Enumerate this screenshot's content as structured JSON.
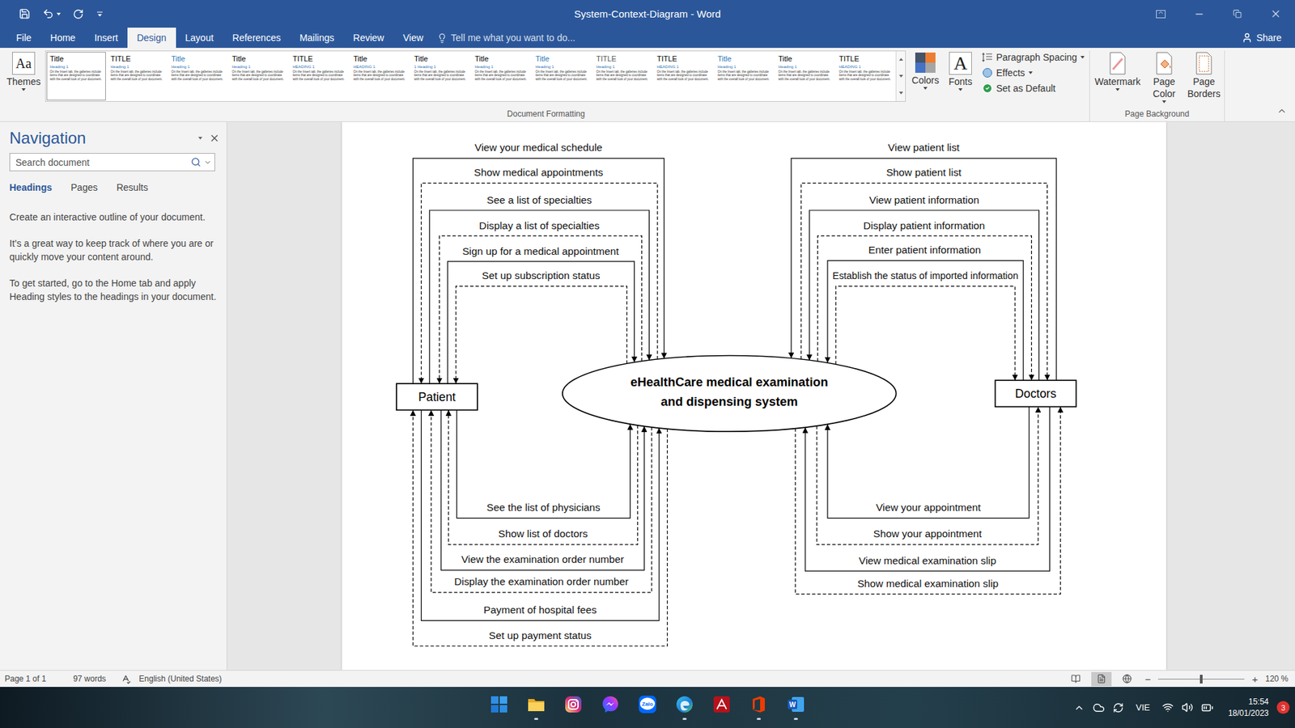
{
  "window": {
    "title": "System-Context-Diagram - Word"
  },
  "ribbon_tabs": [
    {
      "label": "File",
      "selected": false
    },
    {
      "label": "Home",
      "selected": false
    },
    {
      "label": "Insert",
      "selected": false
    },
    {
      "label": "Design",
      "selected": true
    },
    {
      "label": "Layout",
      "selected": false
    },
    {
      "label": "References",
      "selected": false
    },
    {
      "label": "Mailings",
      "selected": false
    },
    {
      "label": "Review",
      "selected": false
    },
    {
      "label": "View",
      "selected": false
    }
  ],
  "tell_me": {
    "placeholder": "Tell me what you want to do..."
  },
  "share": {
    "label": "Share"
  },
  "ribbon": {
    "themes": {
      "icon_text": "Aa",
      "label": "Themes",
      "dropdown": true
    },
    "style_gallery": {
      "sample_text": "On the Insert tab, the galleries include items that are designed to coordinate with the overall look of your document.",
      "items": [
        {
          "title": "Title",
          "heading": "Heading 1",
          "color": "#000000",
          "selected": true
        },
        {
          "title": "TITLE",
          "heading": "Heading 1",
          "color": "#000000",
          "selected": false
        },
        {
          "title": "Title",
          "heading": "Heading 1",
          "color": "#2e74b5",
          "selected": false
        },
        {
          "title": "Title",
          "heading": "Heading 1",
          "color": "#000000",
          "selected": false
        },
        {
          "title": "TITLE",
          "heading": "HEADING 1",
          "color": "#000000",
          "selected": false
        },
        {
          "title": "Title",
          "heading": "HEADING 1",
          "color": "#000000",
          "selected": false
        },
        {
          "title": "Title",
          "heading": "1 Heading 1",
          "color": "#000000",
          "selected": false
        },
        {
          "title": "Title",
          "heading": "Heading 1",
          "color": "#000000",
          "selected": false
        },
        {
          "title": "Title",
          "heading": "Heading 1",
          "color": "#2e74b5",
          "selected": false
        },
        {
          "title": "TITLE",
          "heading": "Heading 1",
          "color": "#555555",
          "selected": false
        },
        {
          "title": "TITLE",
          "heading": "HEADING 1",
          "color": "#000000",
          "selected": false
        },
        {
          "title": "Title",
          "heading": "Heading 1",
          "color": "#2e74b5",
          "selected": false
        },
        {
          "title": "Title",
          "heading": "Heading 1",
          "color": "#000000",
          "selected": false
        },
        {
          "title": "TITLE",
          "heading": "HEADING 1",
          "color": "#000000",
          "selected": false
        }
      ]
    },
    "colors": {
      "label": "Colors",
      "dropdown": true
    },
    "fonts": {
      "icon_text": "A",
      "label": "Fonts",
      "dropdown": true
    },
    "small_buttons": [
      {
        "kind": "paragraph-spacing",
        "label": "Paragraph Spacing",
        "dropdown": true
      },
      {
        "kind": "effects",
        "label": "Effects",
        "dropdown": true
      },
      {
        "kind": "set-default",
        "label": "Set as Default",
        "dropdown": false
      }
    ],
    "groups": [
      {
        "label": "Document Formatting"
      },
      {
        "label": "Page Background"
      }
    ],
    "page_background": [
      {
        "kind": "watermark",
        "lines": [
          "Watermark"
        ],
        "dropdown": true
      },
      {
        "kind": "page-color",
        "lines": [
          "Page",
          "Color"
        ],
        "dropdown": true
      },
      {
        "kind": "page-borders",
        "lines": [
          "Page",
          "Borders"
        ],
        "dropdown": false
      }
    ]
  },
  "navigation": {
    "title": "Navigation",
    "search_placeholder": "Search document",
    "tabs": [
      {
        "label": "Headings",
        "selected": true
      },
      {
        "label": "Pages",
        "selected": false
      },
      {
        "label": "Results",
        "selected": false
      }
    ],
    "paragraphs": [
      "Create an interactive outline of your document.",
      "It’s a great way to keep track of where you are or quickly move your content around.",
      "To get started, go to the Home tab and apply Heading styles to the headings in your document."
    ]
  },
  "diagram": {
    "system": {
      "lines": [
        "eHealthCare medical examination",
        "and dispensing system"
      ]
    },
    "actors": [
      {
        "name": "Patient"
      },
      {
        "name": "Doctors"
      }
    ],
    "flow_groups": [
      {
        "flows": [
          {
            "label": "View your medical schedule",
            "kind": "request"
          },
          {
            "label": "Show medical appointments",
            "kind": "response"
          },
          {
            "label": "See a list of specialties",
            "kind": "request"
          },
          {
            "label": "Display a list of specialties",
            "kind": "response"
          },
          {
            "label": "Sign up for a medical appointment",
            "kind": "request"
          },
          {
            "label": "Set up subscription status",
            "kind": "response"
          }
        ]
      },
      {
        "flows": [
          {
            "label": "See the list of physicians",
            "kind": "request"
          },
          {
            "label": "Show list of doctors",
            "kind": "response"
          },
          {
            "label": "View the examination order number",
            "kind": "request"
          },
          {
            "label": "Display the examination order number",
            "kind": "response"
          },
          {
            "label": "Payment of hospital fees",
            "kind": "request"
          },
          {
            "label": "Set up payment status",
            "kind": "response"
          }
        ]
      },
      {
        "flows": [
          {
            "label": "View patient list",
            "kind": "request"
          },
          {
            "label": "Show patient list",
            "kind": "response"
          },
          {
            "label": "View patient information",
            "kind": "request"
          },
          {
            "label": "Display patient information",
            "kind": "response"
          },
          {
            "label": "Enter patient information",
            "kind": "request"
          },
          {
            "label": "Establish the status of imported information",
            "kind": "response"
          }
        ]
      },
      {
        "flows": [
          {
            "label": "View your appointment",
            "kind": "request"
          },
          {
            "label": "Show your appointment",
            "kind": "response"
          },
          {
            "label": "View medical examination slip",
            "kind": "request"
          },
          {
            "label": "Show medical examination slip",
            "kind": "response"
          }
        ]
      }
    ]
  },
  "status_bar": {
    "page": "Page 1 of 1",
    "words": "97 words",
    "language": "English (United States)",
    "views": [
      {
        "kind": "read",
        "selected": false
      },
      {
        "kind": "print",
        "selected": true
      },
      {
        "kind": "web",
        "selected": false
      }
    ],
    "zoom": {
      "minus": "−",
      "plus": "+",
      "level": 0.5,
      "reading": "120 %"
    }
  },
  "taskbar": {
    "apps": [
      {
        "kind": "start",
        "running": false
      },
      {
        "kind": "explorer",
        "running": true
      },
      {
        "kind": "instagram",
        "running": false
      },
      {
        "kind": "messenger",
        "running": false
      },
      {
        "kind": "zalo",
        "text": "Zalo",
        "running": false
      },
      {
        "kind": "edge",
        "running": true
      },
      {
        "kind": "red-app",
        "running": false
      },
      {
        "kind": "office",
        "running": true
      },
      {
        "kind": "word",
        "text": "W",
        "running": true
      }
    ],
    "tray": {
      "language": "VIE",
      "time": "15:54",
      "date": "18/01/2023",
      "notifications": "3"
    }
  }
}
